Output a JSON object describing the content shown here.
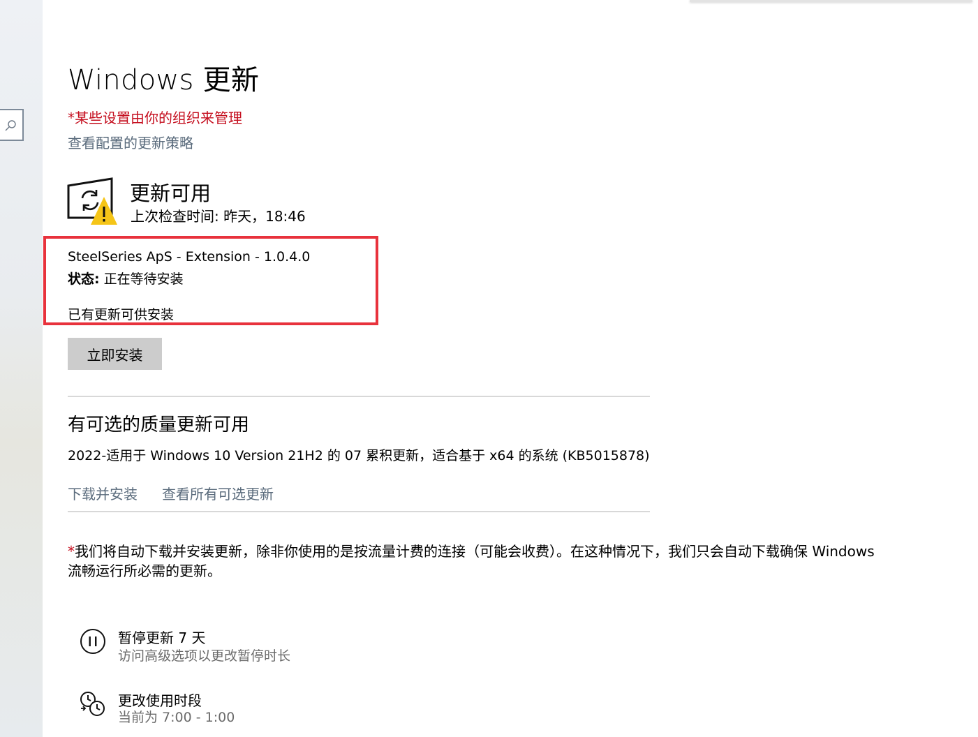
{
  "page": {
    "title": "Windows 更新",
    "org_note": "*某些设置由你的组织来管理",
    "policy_link": "查看配置的更新策略"
  },
  "status": {
    "icon": "update-warning-icon",
    "title": "更新可用",
    "last_check": "上次检查时间: 昨天，18:46"
  },
  "pending_update": {
    "name": "SteelSeries ApS - Extension - 1.0.4.0",
    "state_label": "状态:",
    "state_value": " 正在等待安装",
    "available_text": "已有更新可供安装",
    "install_button": "立即安装"
  },
  "optional": {
    "title": "有可选的质量更新可用",
    "item": "2022-适用于 Windows 10 Version 21H2 的 07 累积更新，适合基于 x64 的系统 (KB5015878)",
    "download_link": "下载并安装",
    "view_all_link": "查看所有可选更新"
  },
  "footnote": {
    "star": "*",
    "text": "我们将自动下载并安装更新，除非你使用的是按流量计费的连接（可能会收费）。在这种情况下，我们只会自动下载确保 Windows 流畅运行所必需的更新。"
  },
  "options": [
    {
      "icon": "pause-icon",
      "title": "暂停更新 7 天",
      "subtitle": "访问高级选项以更改暂停时长"
    },
    {
      "icon": "active-hours-icon",
      "title": "更改使用时段",
      "subtitle": "当前为 7:00 - 1:00"
    }
  ],
  "colors": {
    "org_note": "#c50f1f",
    "link": "#5a6b7c",
    "highlight": "#e8323c",
    "button": "#cccccc",
    "warning": "#f5c518"
  }
}
